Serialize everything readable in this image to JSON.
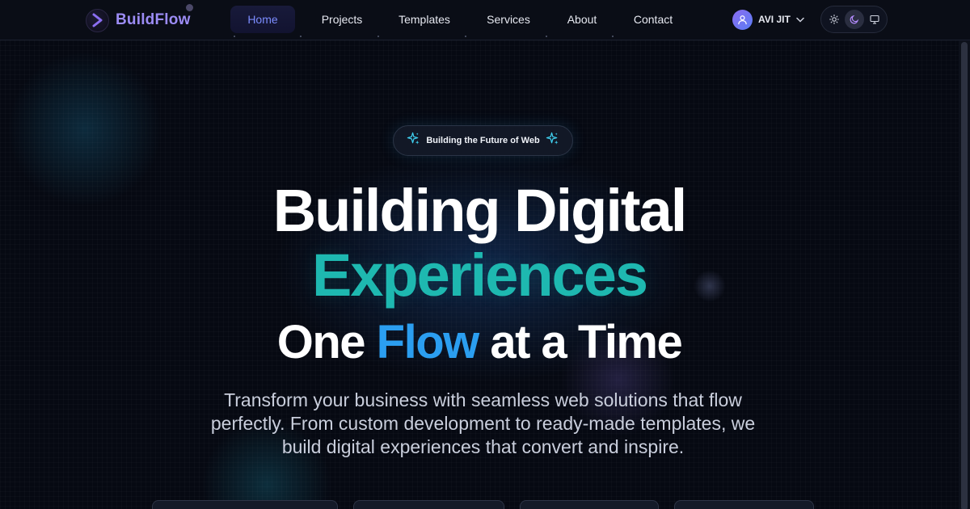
{
  "brand": {
    "name": "BuildFlow",
    "logo_icon": "chevron-right-icon",
    "color": "#9c8cf5"
  },
  "nav": {
    "items": [
      {
        "label": "Home",
        "active": true
      },
      {
        "label": "Projects",
        "active": false
      },
      {
        "label": "Templates",
        "active": false
      },
      {
        "label": "Services",
        "active": false
      },
      {
        "label": "About",
        "active": false
      },
      {
        "label": "Contact",
        "active": false
      }
    ]
  },
  "user": {
    "name": "AVI JIT",
    "avatar_icon": "user-icon",
    "menu_icon": "chevron-down-icon"
  },
  "theme_switch": {
    "options": [
      {
        "icon": "sun-icon",
        "active": false
      },
      {
        "icon": "moon-icon",
        "active": true
      },
      {
        "icon": "monitor-icon",
        "active": false
      }
    ]
  },
  "hero": {
    "badge": "Building the Future of Web",
    "badge_icon": "sparkles-icon",
    "line1": "Building Digital",
    "line2": "Experiences",
    "line3_prefix": "One",
    "line3_accent": "Flow",
    "line3_suffix": "at a Time",
    "subtitle": [
      "Transform your business with seamless web solutions that flow",
      "perfectly. From custom development to ready-made templates, we",
      "build digital experiences that convert and inspire."
    ]
  },
  "colors": {
    "background": "#060912",
    "accent_purple": "#7c8cff",
    "accent_teal": "#1eb8b0",
    "accent_blue": "#2b9ef0"
  }
}
